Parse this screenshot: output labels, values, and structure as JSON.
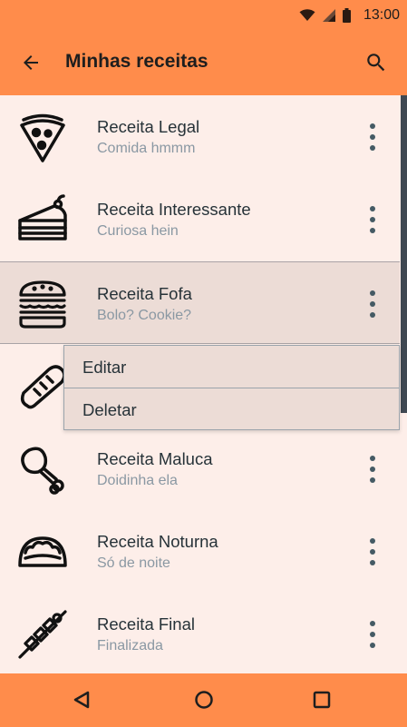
{
  "status": {
    "time": "13:00"
  },
  "app_bar": {
    "title": "Minhas receitas"
  },
  "recipes": [
    {
      "title": "Receita Legal",
      "subtitle": "Comida hmmm",
      "icon": "pizza-icon"
    },
    {
      "title": "Receita Interessante",
      "subtitle": "Curiosa hein",
      "icon": "cake-slice-icon"
    },
    {
      "title": "Receita Fofa",
      "subtitle": "Bolo? Cookie?",
      "icon": "burger-icon"
    },
    {
      "title": "",
      "subtitle": "",
      "icon": "bread-icon"
    },
    {
      "title": "Receita Maluca",
      "subtitle": "Doidinha ela",
      "icon": "chicken-leg-icon"
    },
    {
      "title": "Receita Noturna",
      "subtitle": "Só de noite",
      "icon": "taco-icon"
    },
    {
      "title": "Receita Final",
      "subtitle": "Finalizada",
      "icon": "skewer-icon"
    }
  ],
  "popup_menu": {
    "edit_label": "Editar",
    "delete_label": "Deletar"
  },
  "colors": {
    "primary": "#ff8c4b",
    "background": "#fdeee9",
    "selected": "#ecdcd6",
    "text": "#263238",
    "subtext": "#8a98a3"
  }
}
